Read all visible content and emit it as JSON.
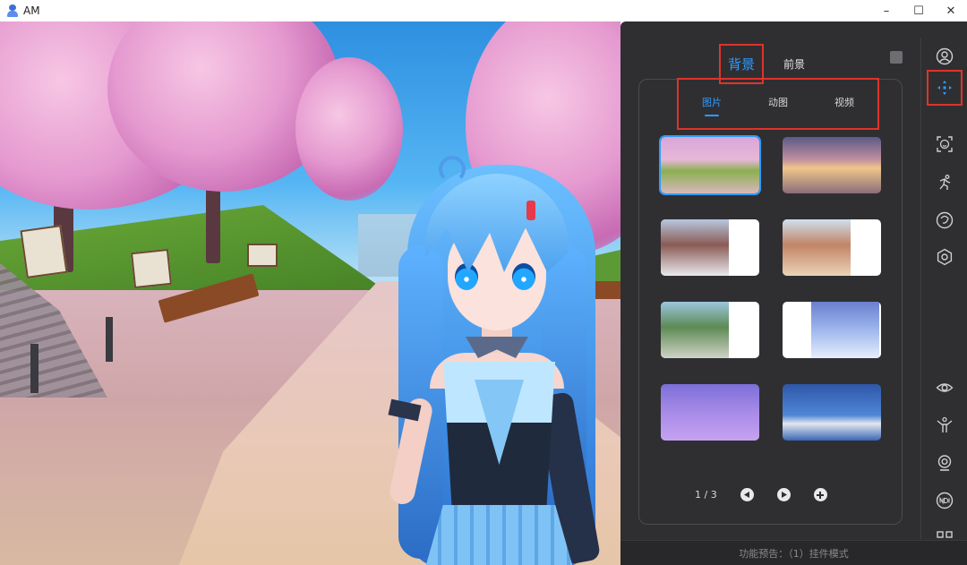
{
  "window": {
    "title": "AM",
    "controls": {
      "minimize": "–",
      "maximize": "☐",
      "close": "✕"
    }
  },
  "panel": {
    "main_tabs": [
      {
        "label": "背景",
        "active": true
      },
      {
        "label": "前景",
        "active": false
      }
    ],
    "sub_tabs": [
      {
        "label": "图片",
        "active": true
      },
      {
        "label": "动图",
        "active": false
      },
      {
        "label": "视频",
        "active": false
      }
    ],
    "thumbnails": [
      {
        "name": "cherry-blossom-park",
        "selected": true
      },
      {
        "name": "sunset-hall",
        "selected": false
      },
      {
        "name": "winter-street",
        "selected": false
      },
      {
        "name": "town-street",
        "selected": false
      },
      {
        "name": "garden-plaza",
        "selected": false
      },
      {
        "name": "snowy-night",
        "selected": false
      },
      {
        "name": "purple-stage",
        "selected": false
      },
      {
        "name": "blue-room",
        "selected": false
      }
    ],
    "pagination": {
      "text": "1 / 3"
    },
    "footer": "功能预告：（1）挂件模式",
    "sidebar_icons": [
      {
        "name": "user-icon",
        "active": false
      },
      {
        "name": "background-move-icon",
        "active": true
      },
      {
        "name": "face-capture-icon",
        "active": false
      },
      {
        "name": "motion-icon",
        "active": false
      },
      {
        "name": "theme-icon",
        "active": false
      },
      {
        "name": "settings-icon",
        "active": false
      },
      {
        "name": "eye-icon",
        "active": false
      },
      {
        "name": "pose-icon",
        "active": false
      },
      {
        "name": "webcam-icon",
        "active": false
      },
      {
        "name": "ndi-icon",
        "active": false
      },
      {
        "name": "qr-icon",
        "active": false
      }
    ]
  },
  "colors": {
    "accent": "#2e9bff",
    "highlight_box": "#e0332a",
    "panel_bg": "#2f2f32"
  }
}
